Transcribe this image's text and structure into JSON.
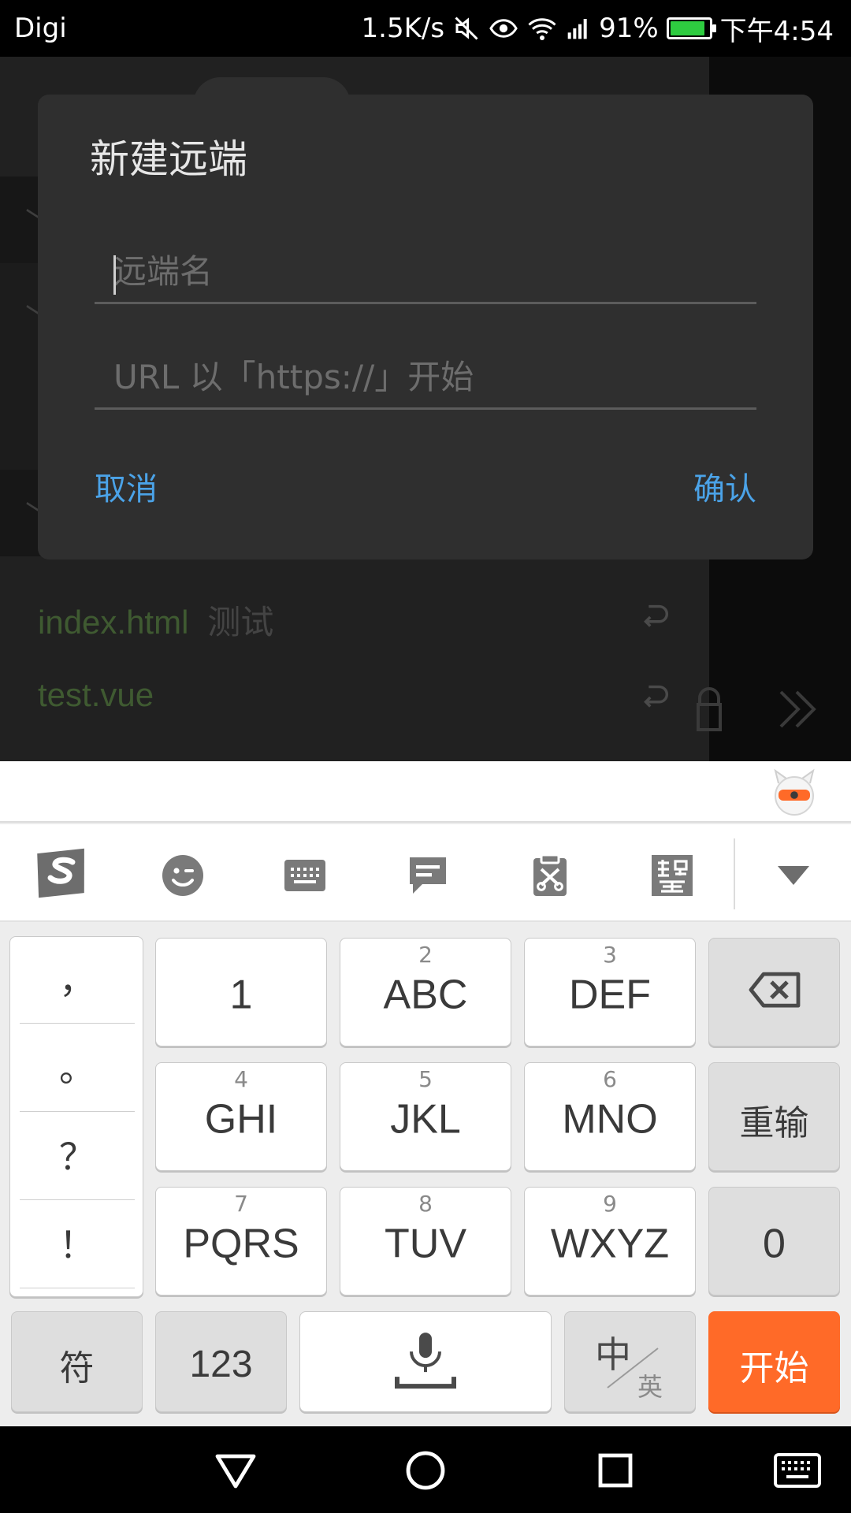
{
  "status_bar": {
    "carrier": "Digi",
    "net_speed": "1.5K/s",
    "battery": "91%",
    "battery_level": 0.91,
    "time": "下午4:54",
    "icons": [
      "mute-icon",
      "eye-icon",
      "wifi-icon",
      "signal-icon",
      "battery-icon"
    ]
  },
  "background": {
    "files": [
      {
        "name": "index.html",
        "message": "测试"
      },
      {
        "name": "test.vue",
        "message": ""
      }
    ]
  },
  "dialog": {
    "title": "新建远端",
    "remote_name_placeholder": "远端名",
    "url_placeholder": "URL 以「https://」开始",
    "cancel_label": "取消",
    "confirm_label": "确认"
  },
  "keyboard": {
    "toolbar": [
      "sogou-logo-icon",
      "emoji-icon",
      "keyboard-icon",
      "quick-reply-icon",
      "clipboard-icon",
      "traditional-chinese-icon",
      "collapse-keyboard-icon"
    ],
    "punctuation": [
      "，",
      "。",
      "？",
      "！"
    ],
    "keys": [
      {
        "num": "",
        "label": "1"
      },
      {
        "num": "2",
        "label": "ABC"
      },
      {
        "num": "3",
        "label": "DEF"
      },
      {
        "num": "4",
        "label": "GHI"
      },
      {
        "num": "5",
        "label": "JKL"
      },
      {
        "num": "6",
        "label": "MNO"
      },
      {
        "num": "7",
        "label": "PQRS"
      },
      {
        "num": "8",
        "label": "TUV"
      },
      {
        "num": "9",
        "label": "WXYZ"
      }
    ],
    "reenter_label": "重输",
    "zero_label": "0",
    "symbol_label": "符",
    "numeric_label": "123",
    "lang_main": "中",
    "lang_sub": "英",
    "go_label": "开始",
    "accent_color": "#ff6a28"
  },
  "colors": {
    "link_blue": "#4ba3e8",
    "dialog_bg": "#2f2f2f"
  }
}
